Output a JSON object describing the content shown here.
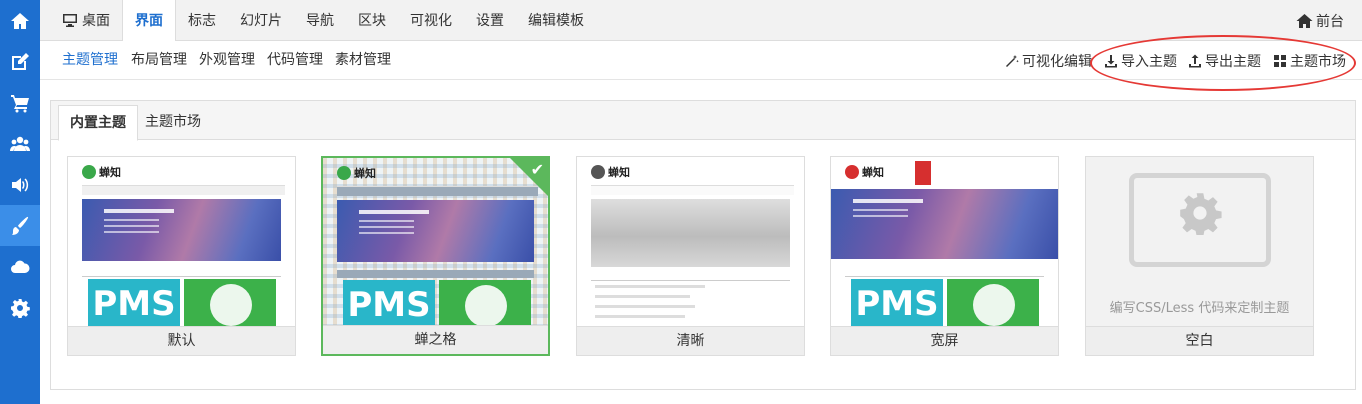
{
  "rail": {
    "items": [
      {
        "icon": "home-icon"
      },
      {
        "icon": "edit-icon"
      },
      {
        "icon": "cart-icon"
      },
      {
        "icon": "users-icon"
      },
      {
        "icon": "volume-icon"
      },
      {
        "icon": "brush-icon"
      },
      {
        "icon": "cloud-icon"
      },
      {
        "icon": "gear-icon"
      }
    ],
    "active_index": 5
  },
  "topnav": {
    "items": [
      "桌面",
      "界面",
      "标志",
      "幻灯片",
      "导航",
      "区块",
      "可视化",
      "设置",
      "编辑模板"
    ],
    "active": "界面",
    "front": "前台"
  },
  "subnav": {
    "left": [
      "主题管理",
      "布局管理",
      "外观管理",
      "代码管理",
      "素材管理"
    ],
    "active": "主题管理",
    "right": {
      "visual_edit": "可视化编辑",
      "import": "导入主题",
      "export": "导出主题",
      "market": "主题市场"
    }
  },
  "panel": {
    "tabs": [
      "内置主题",
      "主题市场"
    ],
    "active_tab": "内置主题",
    "themes": [
      {
        "label": "默认",
        "logo": "蝉知",
        "tagline": "为天下企业提供专业的营销工具!"
      },
      {
        "label": "蝉之格",
        "logo": "蝉知",
        "selected": true
      },
      {
        "label": "清晰",
        "logo": "蝉知"
      },
      {
        "label": "宽屏",
        "logo": "蝉知"
      },
      {
        "label": "空白",
        "hint": "编写CSS/Less 代码来定制主题"
      }
    ],
    "pms_text": "PMS"
  },
  "colors": {
    "rail": "#1e6fcf",
    "accent": "#1e6fcf",
    "selected": "#5cb85c",
    "annotation": "#e53935"
  }
}
